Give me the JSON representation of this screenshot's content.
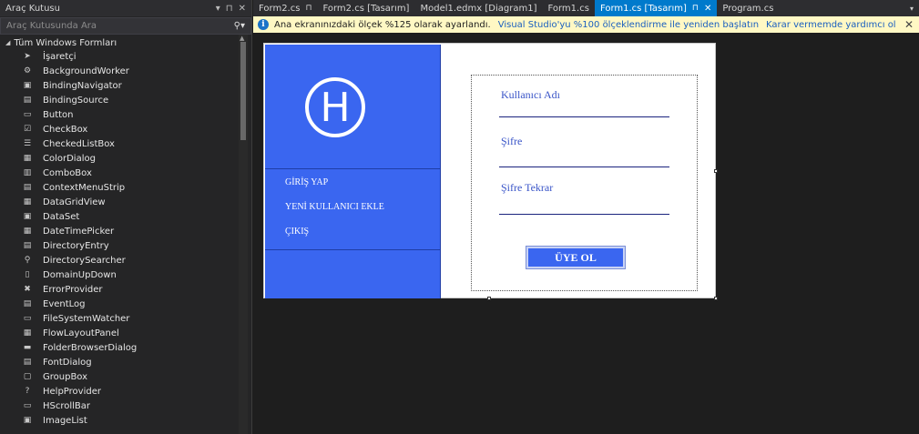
{
  "toolbox": {
    "title": "Araç Kutusu",
    "header_controls": [
      "▾",
      "⊓",
      "✕"
    ],
    "search_placeholder": "Araç Kutusunda Ara",
    "group_label": "Tüm Windows Formları",
    "items": [
      {
        "label": "İşaretçi",
        "icon": "pointer-icon",
        "glyph": "➤"
      },
      {
        "label": "BackgroundWorker",
        "icon": "backgroundworker-icon",
        "glyph": "⚙"
      },
      {
        "label": "BindingNavigator",
        "icon": "bindingnavigator-icon",
        "glyph": "▣"
      },
      {
        "label": "BindingSource",
        "icon": "bindingsource-icon",
        "glyph": "▤"
      },
      {
        "label": "Button",
        "icon": "button-icon",
        "glyph": "▭"
      },
      {
        "label": "CheckBox",
        "icon": "checkbox-icon",
        "glyph": "☑"
      },
      {
        "label": "CheckedListBox",
        "icon": "checkedlistbox-icon",
        "glyph": "☰"
      },
      {
        "label": "ColorDialog",
        "icon": "colordialog-icon",
        "glyph": "▦"
      },
      {
        "label": "ComboBox",
        "icon": "combobox-icon",
        "glyph": "▥"
      },
      {
        "label": "ContextMenuStrip",
        "icon": "contextmenustrip-icon",
        "glyph": "▤"
      },
      {
        "label": "DataGridView",
        "icon": "datagridview-icon",
        "glyph": "▦"
      },
      {
        "label": "DataSet",
        "icon": "dataset-icon",
        "glyph": "▣"
      },
      {
        "label": "DateTimePicker",
        "icon": "datetimepicker-icon",
        "glyph": "▦"
      },
      {
        "label": "DirectoryEntry",
        "icon": "directoryentry-icon",
        "glyph": "▤"
      },
      {
        "label": "DirectorySearcher",
        "icon": "directorysearcher-icon",
        "glyph": "⚲"
      },
      {
        "label": "DomainUpDown",
        "icon": "domainupdown-icon",
        "glyph": "▯"
      },
      {
        "label": "ErrorProvider",
        "icon": "errorprovider-icon",
        "glyph": "✖"
      },
      {
        "label": "EventLog",
        "icon": "eventlog-icon",
        "glyph": "▤"
      },
      {
        "label": "FileSystemWatcher",
        "icon": "filesystemwatcher-icon",
        "glyph": "▭"
      },
      {
        "label": "FlowLayoutPanel",
        "icon": "flowlayoutpanel-icon",
        "glyph": "▦"
      },
      {
        "label": "FolderBrowserDialog",
        "icon": "folderbrowserdialog-icon",
        "glyph": "▬"
      },
      {
        "label": "FontDialog",
        "icon": "fontdialog-icon",
        "glyph": "▤"
      },
      {
        "label": "GroupBox",
        "icon": "groupbox-icon",
        "glyph": "▢"
      },
      {
        "label": "HelpProvider",
        "icon": "helpprovider-icon",
        "glyph": "?"
      },
      {
        "label": "HScrollBar",
        "icon": "hscrollbar-icon",
        "glyph": "▭"
      },
      {
        "label": "ImageList",
        "icon": "imagelist-icon",
        "glyph": "▣"
      }
    ]
  },
  "tabs": [
    {
      "label": "Form2.cs",
      "pin": "⊓",
      "close": ""
    },
    {
      "label": "Form2.cs [Tasarım]",
      "pin": "",
      "close": ""
    },
    {
      "label": "Model1.edmx [Diagram1]",
      "pin": "",
      "close": ""
    },
    {
      "label": "Form1.cs",
      "pin": "",
      "close": ""
    },
    {
      "label": "Form1.cs [Tasarım]",
      "pin": "⊓",
      "close": "✕",
      "active": true
    },
    {
      "label": "Program.cs",
      "pin": "",
      "close": ""
    }
  ],
  "infobar": {
    "message": "Ana ekranınızdaki ölçek %125 olarak ayarlandı.",
    "link_restart": "Visual Studio'yu %100 ölçeklendirme ile yeniden başlatın",
    "link_help": "Karar vermemde yardımcı ol",
    "close": "✕"
  },
  "form": {
    "logo_letter": "H",
    "menu": [
      "GİRİŞ YAP",
      "YENİ KULLANICI EKLE",
      "ÇIKIŞ"
    ],
    "fields": [
      "Kullanıcı Adı",
      "Şifre",
      "Şifre Tekrar"
    ],
    "register_button": "ÜYE OL"
  },
  "colors": {
    "accent": "#007acc",
    "form_blue": "#3a66f0",
    "infobar_bg": "#fff8c4"
  }
}
